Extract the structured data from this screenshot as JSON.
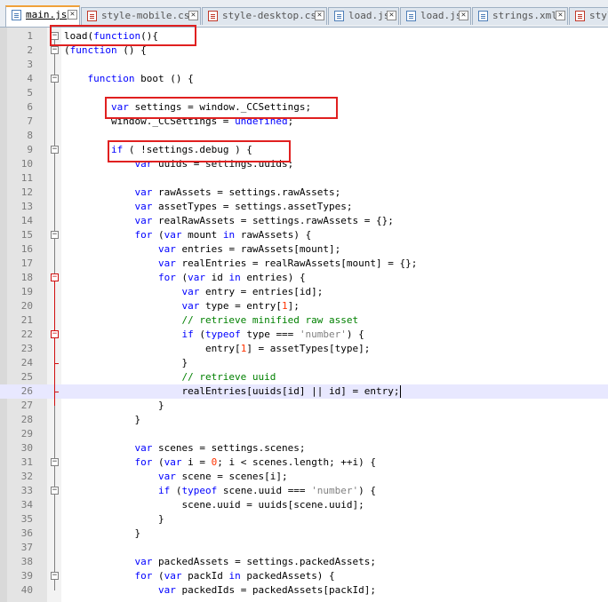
{
  "tabs": [
    {
      "label": "main.js",
      "icon": "file-js-icon",
      "active": true
    },
    {
      "label": "style-mobile.css",
      "icon": "file-css-icon",
      "active": false
    },
    {
      "label": "style-desktop.css",
      "icon": "file-css-icon",
      "active": false
    },
    {
      "label": "load.js",
      "icon": "file-js-icon",
      "active": false
    },
    {
      "label": "load.js",
      "icon": "file-js-icon",
      "active": false
    },
    {
      "label": "strings.xml",
      "icon": "file-xml-icon",
      "active": false
    },
    {
      "label": "styl",
      "icon": "file-css-icon",
      "active": false
    }
  ],
  "editor": {
    "current_line": 26,
    "lines": [
      {
        "n": "1",
        "c": "load(function(){"
      },
      {
        "n": "2",
        "c": "(function () {"
      },
      {
        "n": "3",
        "c": ""
      },
      {
        "n": "4",
        "c": "    function boot () {"
      },
      {
        "n": "5",
        "c": ""
      },
      {
        "n": "6",
        "c": "        var settings = window._CCSettings;"
      },
      {
        "n": "7",
        "c": "        window._CCSettings = undefined;"
      },
      {
        "n": "8",
        "c": ""
      },
      {
        "n": "9",
        "c": "        if ( !settings.debug ) {"
      },
      {
        "n": "10",
        "c": "            var uuids = settings.uuids;"
      },
      {
        "n": "11",
        "c": ""
      },
      {
        "n": "12",
        "c": "            var rawAssets = settings.rawAssets;"
      },
      {
        "n": "13",
        "c": "            var assetTypes = settings.assetTypes;"
      },
      {
        "n": "14",
        "c": "            var realRawAssets = settings.rawAssets = {};"
      },
      {
        "n": "15",
        "c": "            for (var mount in rawAssets) {"
      },
      {
        "n": "16",
        "c": "                var entries = rawAssets[mount];"
      },
      {
        "n": "17",
        "c": "                var realEntries = realRawAssets[mount] = {};"
      },
      {
        "n": "18",
        "c": "                for (var id in entries) {"
      },
      {
        "n": "19",
        "c": "                    var entry = entries[id];"
      },
      {
        "n": "20",
        "c": "                    var type = entry[1];"
      },
      {
        "n": "21",
        "c": "                    // retrieve minified raw asset"
      },
      {
        "n": "22",
        "c": "                    if (typeof type === 'number') {"
      },
      {
        "n": "23",
        "c": "                        entry[1] = assetTypes[type];"
      },
      {
        "n": "24",
        "c": "                    }"
      },
      {
        "n": "25",
        "c": "                    // retrieve uuid"
      },
      {
        "n": "26",
        "c": "                    realEntries[uuids[id] || id] = entry;"
      },
      {
        "n": "27",
        "c": "                }"
      },
      {
        "n": "28",
        "c": "            }"
      },
      {
        "n": "29",
        "c": ""
      },
      {
        "n": "30",
        "c": "            var scenes = settings.scenes;"
      },
      {
        "n": "31",
        "c": "            for (var i = 0; i < scenes.length; ++i) {"
      },
      {
        "n": "32",
        "c": "                var scene = scenes[i];"
      },
      {
        "n": "33",
        "c": "                if (typeof scene.uuid === 'number') {"
      },
      {
        "n": "34",
        "c": "                    scene.uuid = uuids[scene.uuid];"
      },
      {
        "n": "35",
        "c": "                }"
      },
      {
        "n": "36",
        "c": "            }"
      },
      {
        "n": "37",
        "c": ""
      },
      {
        "n": "38",
        "c": "            var packedAssets = settings.packedAssets;"
      },
      {
        "n": "39",
        "c": "            for (var packId in packedAssets) {"
      },
      {
        "n": "40",
        "c": "                var packedIds = packedAssets[packId];"
      }
    ]
  },
  "colors": {
    "keyword": "#0000ff",
    "string": "#808080",
    "number": "#ff3300",
    "comment": "#008000",
    "highlight_box": "#e02020",
    "current_line": "#e8e8ff"
  }
}
